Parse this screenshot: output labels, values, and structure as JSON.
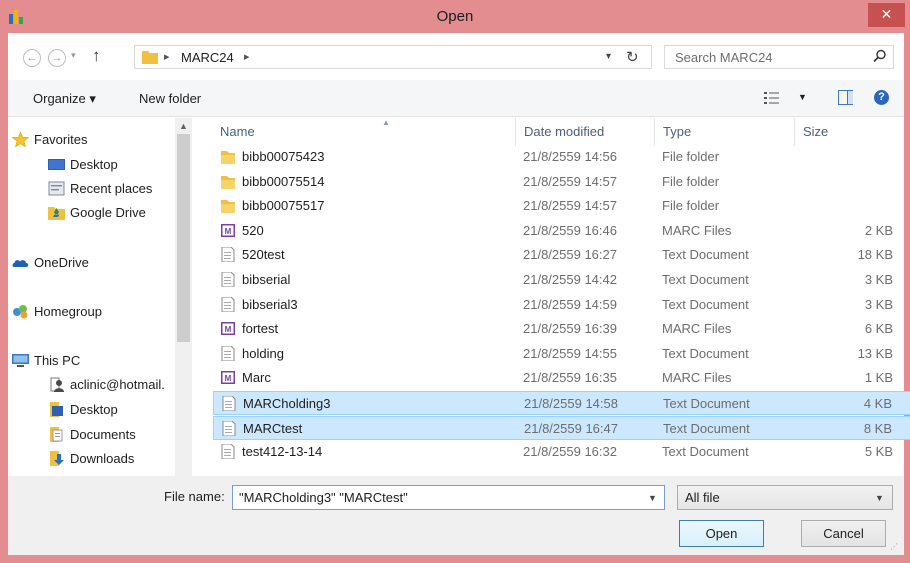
{
  "window": {
    "title": "Open",
    "close_label": "✕"
  },
  "address": {
    "path": [
      "MARC24"
    ],
    "search_placeholder": "Search MARC24"
  },
  "toolbar": {
    "organize_label": "Organize ▾",
    "new_folder_label": "New folder"
  },
  "nav": {
    "items": [
      {
        "label": "Favorites",
        "icon": "star-icon",
        "color": "#f4c430"
      },
      {
        "label": "Desktop",
        "icon": "desktop-icon",
        "color": "#2f5fb0"
      },
      {
        "label": "Recent places",
        "icon": "recent-places-icon",
        "color": "#7a8aa0"
      },
      {
        "label": "Google Drive",
        "icon": "google-drive-icon",
        "color": "#f0c040"
      },
      {
        "label": "OneDrive",
        "icon": "onedrive-icon",
        "color": "#1f5fb5"
      },
      {
        "label": "Homegroup",
        "icon": "homegroup-icon",
        "color": "#3d8fd6"
      },
      {
        "label": "This PC",
        "icon": "computer-icon",
        "color": "#3a78c4"
      },
      {
        "label": "aclinic@hotmail.",
        "icon": "user-folder-icon",
        "color": "#7a7a7a"
      },
      {
        "label": "Desktop",
        "icon": "desktop-folder-icon",
        "color": "#f0c040"
      },
      {
        "label": "Documents",
        "icon": "documents-folder-icon",
        "color": "#f0c040"
      },
      {
        "label": "Downloads",
        "icon": "downloads-folder-icon",
        "color": "#f0c040"
      }
    ]
  },
  "columns": {
    "name": "Name",
    "date": "Date modified",
    "type": "Type",
    "size": "Size"
  },
  "files": [
    {
      "name": "bibb00075423",
      "date": "21/8/2559 14:56",
      "type": "File folder",
      "size": "",
      "icon": "folder-icon"
    },
    {
      "name": "bibb00075514",
      "date": "21/8/2559 14:57",
      "type": "File folder",
      "size": "",
      "icon": "folder-icon"
    },
    {
      "name": "bibb00075517",
      "date": "21/8/2559 14:57",
      "type": "File folder",
      "size": "",
      "icon": "folder-icon"
    },
    {
      "name": "520",
      "date": "21/8/2559 16:46",
      "type": "MARC Files",
      "size": "2 KB",
      "icon": "marc-file-icon"
    },
    {
      "name": "520test",
      "date": "21/8/2559 16:27",
      "type": "Text Document",
      "size": "18 KB",
      "icon": "text-file-icon"
    },
    {
      "name": "bibserial",
      "date": "21/8/2559 14:42",
      "type": "Text Document",
      "size": "3 KB",
      "icon": "text-file-icon"
    },
    {
      "name": "bibserial3",
      "date": "21/8/2559 14:59",
      "type": "Text Document",
      "size": "3 KB",
      "icon": "text-file-icon"
    },
    {
      "name": "fortest",
      "date": "21/8/2559 16:39",
      "type": "MARC Files",
      "size": "6 KB",
      "icon": "marc-file-icon"
    },
    {
      "name": "holding",
      "date": "21/8/2559 14:55",
      "type": "Text Document",
      "size": "13 KB",
      "icon": "text-file-icon"
    },
    {
      "name": "Marc",
      "date": "21/8/2559 16:35",
      "type": "MARC Files",
      "size": "1 KB",
      "icon": "marc-file-icon"
    },
    {
      "name": "MARCholding3",
      "date": "21/8/2559 14:58",
      "type": "Text Document",
      "size": "4 KB",
      "icon": "text-file-icon",
      "selected": true
    },
    {
      "name": "MARCtest",
      "date": "21/8/2559 16:47",
      "type": "Text Document",
      "size": "8 KB",
      "icon": "text-file-icon",
      "selected": true
    },
    {
      "name": "test412-13-14",
      "date": "21/8/2559 16:32",
      "type": "Text Document",
      "size": "5 KB",
      "icon": "text-file-icon"
    }
  ],
  "footer": {
    "file_name_label": "File name:",
    "file_name_value": "\"MARCholding3\" \"MARCtest\"",
    "filter_value": "All file",
    "open_label": "Open",
    "cancel_label": "Cancel"
  },
  "colors": {
    "titlebar": "#e48d91",
    "close": "#c75050",
    "selection": "#cce8ff",
    "folder": "#f0c040",
    "marc": "#7b3fa0"
  }
}
